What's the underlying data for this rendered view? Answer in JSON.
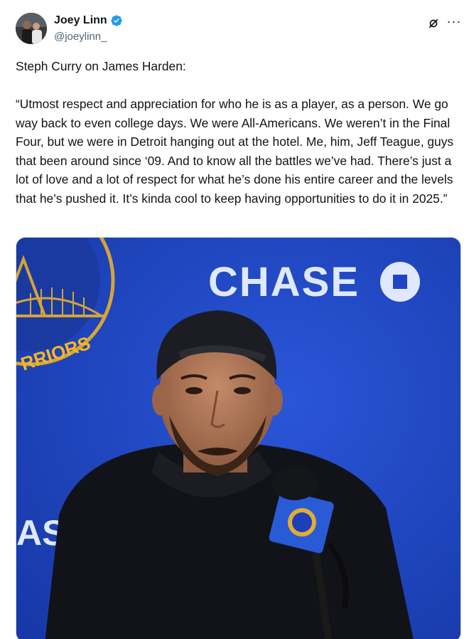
{
  "author": {
    "display_name": "Joey Linn",
    "handle": "@joeylinn_",
    "verified": true,
    "avatar_icon": "user-avatar"
  },
  "actions": {
    "grok_icon": "grok-icon",
    "more_icon": "more-options-icon",
    "more_glyph": "···"
  },
  "tweet": {
    "text": "Steph Curry on James Harden:\n\n“Utmost respect and appreciation for who he is as a player, as a person. We go way back to even college days. We were All-Americans. We weren’t in the Final Four, but we were in Detroit hanging out at the hotel. Me, him, Jeff Teague, guys that been around since ‘09. And to know all the battles we’ve had. There’s just a lot of love and a lot of respect for what he’s done his entire career and the levels that he’s pushed it. It’s kinda cool to keep having opportunities to do it in 2025.”"
  },
  "media": {
    "backdrop_brand": "CHASE",
    "backdrop_partial_left": "AS",
    "backdrop_team_fragment": "RRIORS",
    "colors": {
      "backdrop": "#1f45c4",
      "brand_text": "#dfe8ff",
      "warriors_gold": "#f5b623",
      "cap": "#1c1d22",
      "jacket": "#111216",
      "skin": "#b27a5c"
    }
  },
  "colors": {
    "text": "#0f1419",
    "secondary": "#536471",
    "verified": "#1d9bf0",
    "border": "#cfd9de"
  }
}
